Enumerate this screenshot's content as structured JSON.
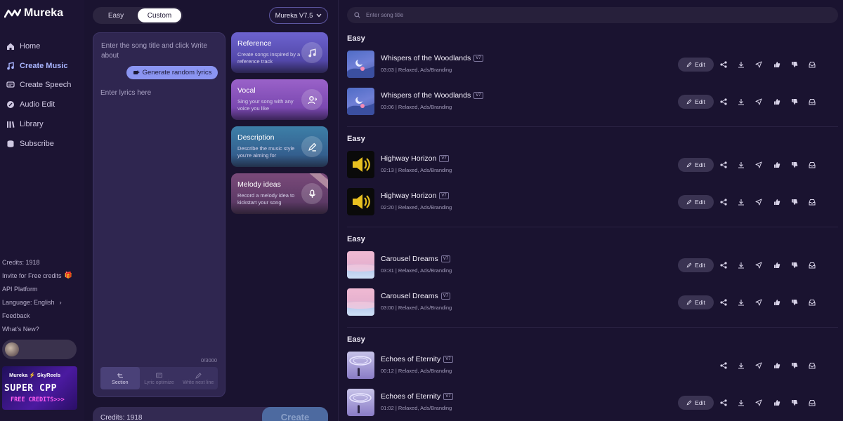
{
  "app": {
    "name": "Mureka"
  },
  "sidebar": {
    "nav": [
      {
        "label": "Home",
        "icon": "home-icon",
        "active": false
      },
      {
        "label": "Create Music",
        "icon": "music-note-icon",
        "active": true
      },
      {
        "label": "Create Speech",
        "icon": "speech-icon",
        "active": false
      },
      {
        "label": "Audio Edit",
        "icon": "audio-edit-icon",
        "active": false
      },
      {
        "label": "Library",
        "icon": "library-icon",
        "active": false
      },
      {
        "label": "Subscribe",
        "icon": "subscribe-icon",
        "active": false
      }
    ],
    "credits": "Credits: 1918",
    "invite": "Invite for Free credits",
    "api": "API Platform",
    "language": "Language: English",
    "feedback": "Feedback",
    "whats_new": "What's New?",
    "promo": {
      "top": "Mureka ⚡ SkyReels",
      "big": "SUPER CPP",
      "free": "FREE CREDITS>>>"
    }
  },
  "composer": {
    "modes": [
      "Easy",
      "Custom"
    ],
    "active_mode": "Custom",
    "model": "Mureka V7.5",
    "lyrics_hint": "Enter the song title and click Write about",
    "generate_label": "Generate random lyrics",
    "lyrics_placeholder": "Enter lyrics here",
    "char_count": "0/3000",
    "tools": [
      {
        "label": "Section",
        "active": true
      },
      {
        "label": "Lyric optimize",
        "active": false
      },
      {
        "label": "Write next line",
        "active": false
      }
    ],
    "cards": [
      {
        "title": "Reference",
        "desc": "Create songs inspired by a reference track",
        "icon": "music-note-icon"
      },
      {
        "title": "Vocal",
        "desc": "Sing your song with any voice you like",
        "icon": "voice-user-icon"
      },
      {
        "title": "Description",
        "desc": "Describe the music style you're aiming for",
        "icon": "pen-icon"
      },
      {
        "title": "Melody ideas",
        "desc": "Record a melody idea to kickstart your song",
        "icon": "microphone-icon"
      }
    ],
    "credits": "Credits: 1918",
    "create_label": "Create"
  },
  "library": {
    "search_placeholder": "Enter song title",
    "edit_label": "Edit",
    "groups": [
      {
        "title": "Easy",
        "songs": [
          {
            "title": "Whispers of the Woodlands",
            "version": "V7",
            "meta": "03:03 | Relaxed, Ads/Branding",
            "thumb": "woods",
            "edit": true
          },
          {
            "title": "Whispers of the Woodlands",
            "version": "V7",
            "meta": "03:06 | Relaxed, Ads/Branding",
            "thumb": "woods",
            "edit": true
          }
        ]
      },
      {
        "title": "Easy",
        "songs": [
          {
            "title": "Highway Horizon",
            "version": "V7",
            "meta": "02:13 | Relaxed, Ads/Branding",
            "thumb": "horizon",
            "edit": true
          },
          {
            "title": "Highway Horizon",
            "version": "V7",
            "meta": "02:20 | Relaxed, Ads/Branding",
            "thumb": "horizon",
            "edit": true
          }
        ]
      },
      {
        "title": "Easy",
        "songs": [
          {
            "title": "Carousel Dreams",
            "version": "V7",
            "meta": "03:31 | Relaxed, Ads/Branding",
            "thumb": "carousel",
            "edit": true
          },
          {
            "title": "Carousel Dreams",
            "version": "V7",
            "meta": "03:00 | Relaxed, Ads/Branding",
            "thumb": "carousel",
            "edit": true
          }
        ]
      },
      {
        "title": "Easy",
        "songs": [
          {
            "title": "Echoes of Eternity",
            "version": "V7",
            "meta": "00:12 | Relaxed, Ads/Branding",
            "thumb": "echoes",
            "edit": false
          },
          {
            "title": "Echoes of Eternity",
            "version": "V7",
            "meta": "01:02 | Relaxed, Ads/Branding",
            "thumb": "echoes",
            "edit": true
          }
        ]
      }
    ],
    "action_icons": [
      "share-icon",
      "download-icon",
      "send-icon",
      "thumbs-up-icon",
      "thumbs-down-icon",
      "inbox-icon"
    ]
  },
  "colors": {
    "accent": "#8b95f2",
    "background": "#1a1330",
    "active_nav": "#a9b5ff"
  }
}
